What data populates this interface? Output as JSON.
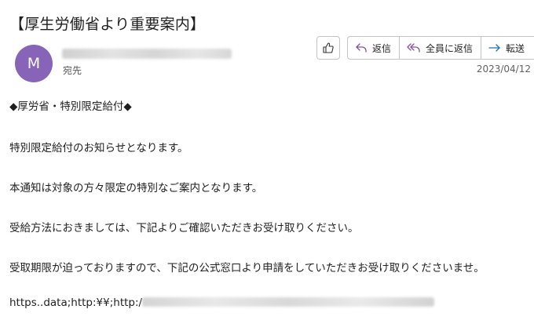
{
  "email": {
    "subject": "【厚生労働省より重要案内】",
    "sender_initial": "M",
    "to_label": "宛先",
    "date": "2023/04/12"
  },
  "actions": {
    "reply": "返信",
    "reply_all": "全員に返信",
    "forward": "転送"
  },
  "body": {
    "line1": "◆厚労省・特別限定給付◆",
    "line2": "特別限定給付のお知らせとなります。",
    "line3": "本通知は対象の方々限定の特別なご案内となります。",
    "line4": "受給方法におきましては、下記よりご確認いただきお受け取りください。",
    "line5": "受取期限が迫っておりますので、下記の公式窓口より申請をしていただきお受け取りくださいませ。",
    "link_prefix": "https..data;http:¥¥;http:/"
  },
  "icons": {
    "like": "thumbs-up-icon",
    "reply": "reply-arrow-icon",
    "reply_all": "reply-all-arrow-icon",
    "forward": "forward-arrow-icon"
  },
  "colors": {
    "avatar": "#8764b8",
    "reply_icon": "#8a4d9f",
    "forward_icon": "#1c6fbf"
  }
}
